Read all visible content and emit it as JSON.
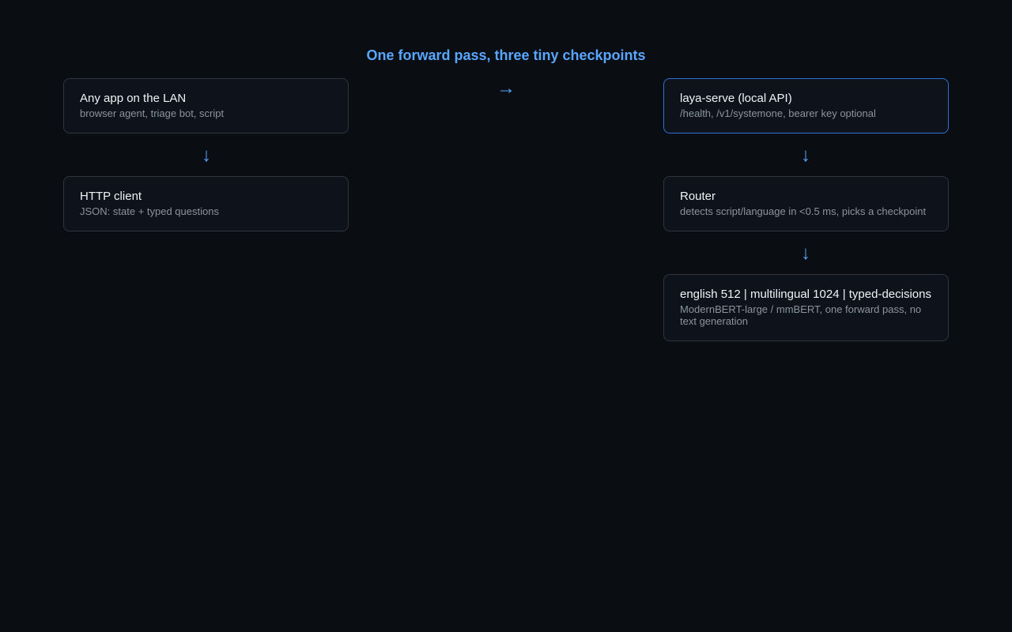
{
  "title": "One forward pass, three tiny checkpoints",
  "arrows": {
    "right": "→",
    "down": "↓"
  },
  "colors": {
    "background": "#0a0d12",
    "accent": "#58a6ff",
    "card_border": "#30363d",
    "highlight_border": "#2f6fd8"
  },
  "left_column": [
    {
      "title": "Any app on the LAN",
      "subtitle": "browser agent, triage bot, script"
    },
    {
      "title": "HTTP client",
      "subtitle": "JSON: state + typed questions"
    }
  ],
  "right_column": [
    {
      "title": "laya-serve (local API)",
      "subtitle": "/health, /v1/systemone, bearer key optional"
    },
    {
      "title": "Router",
      "subtitle": "detects script/language in <0.5 ms, picks a checkpoint"
    },
    {
      "title": "english 512 | multilingual 1024 | typed-decisions",
      "subtitle": "ModernBERT-large / mmBERT, one forward pass, no text generation"
    }
  ]
}
